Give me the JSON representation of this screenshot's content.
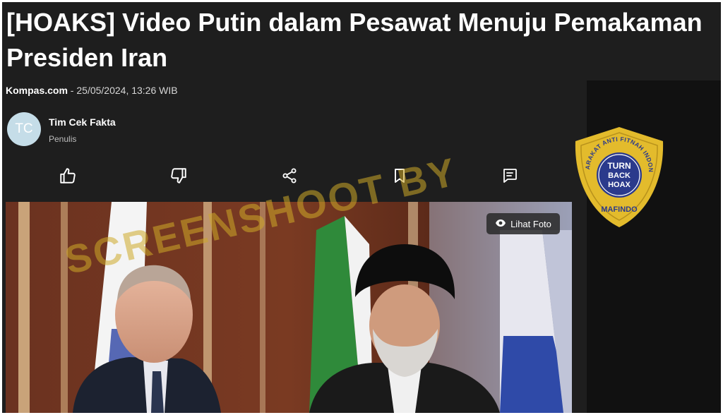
{
  "article": {
    "title": "[HOAKS] Video Putin dalam Pesawat Menuju Pemakaman Presiden Iran",
    "source": "Kompas.com",
    "date_sep": " - ",
    "date": "25/05/2024, 13:26 WIB"
  },
  "author": {
    "initials": "TC",
    "name": "Tim Cek Fakta",
    "role": "Penulis"
  },
  "actions": [
    {
      "icon": "thumbs-up-icon"
    },
    {
      "icon": "thumbs-down-icon"
    },
    {
      "icon": "share-icon"
    },
    {
      "icon": "bookmark-icon"
    },
    {
      "icon": "comment-icon"
    }
  ],
  "photo": {
    "view_label": "Lihat Foto",
    "view_icon": "eye-icon"
  },
  "watermark": {
    "text": "SCREENSHOOT BY"
  },
  "badge": {
    "arc_text": "MASYARAKAT ANTI FITNAH INDONESIA",
    "line1": "TURN",
    "line2": "BACK",
    "line3": "HOAX",
    "bottom": "MAFINDO"
  },
  "colors": {
    "background": "#1e1e1e",
    "text": "#ffffff",
    "badge_gold": "#e3bb2c",
    "badge_navy": "#2b3a8c"
  }
}
